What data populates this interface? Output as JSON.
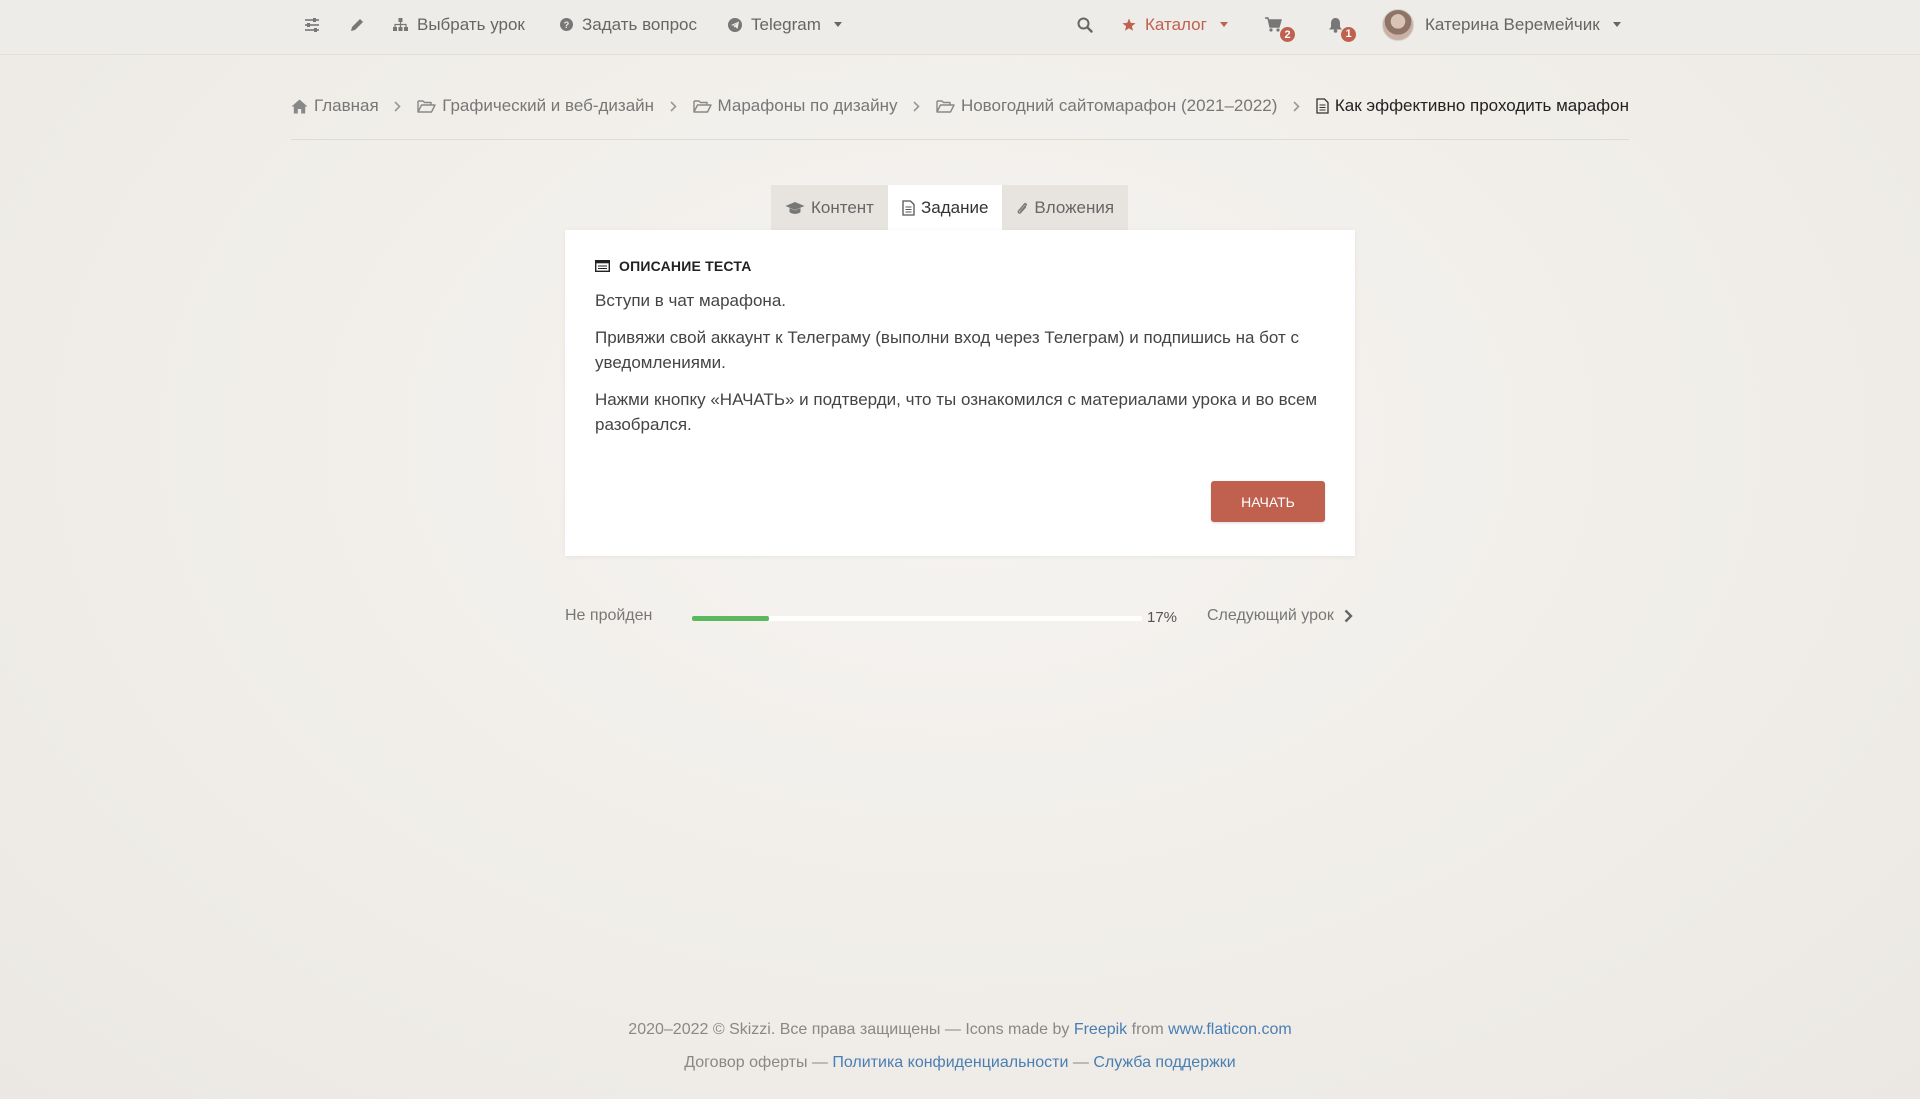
{
  "nav": {
    "choose_lesson": "Выбрать урок",
    "ask_question": "Задать вопрос",
    "telegram": "Telegram",
    "catalog": "Каталог",
    "cart_count": "2",
    "notifications_count": "1",
    "user_name": "Катерина Веремейчик"
  },
  "breadcrumb": {
    "home": "Главная",
    "level1": "Графический и веб-дизайн",
    "level2": "Марафоны по дизайну",
    "level3": "Новогодний сайтомарафон (2021–2022)",
    "current": "Как эффективно проходить марафон"
  },
  "tabs": {
    "content": "Контент",
    "task": "Задание",
    "attachments": "Вложения"
  },
  "card": {
    "title": "ОПИСАНИЕ ТЕСТА",
    "paragraphs": [
      "Вступи в чат марафона.",
      "Привяжи свой аккаунт к Телеграму (выполни вход через Телеграм) и подпишись на бот с уведомлениями.",
      "Нажми кнопку «НАЧАТЬ» и подтверди, что ты ознакомился с материалами урока и во всем разобрался."
    ],
    "start_button": "НАЧАТЬ"
  },
  "progress": {
    "status": "Не пройден",
    "percent": "17%",
    "fraction": 0.17,
    "next_lesson": "Следующий урок"
  },
  "footer": {
    "copyright": "2020–2022 © Skizzi. Все права защищены — Icons made by",
    "freepik": "Freepik",
    "from": "from",
    "flaticon": "www.flaticon.com",
    "offer": "Договор оферты —",
    "privacy": "Политика конфиденциальности",
    "dash": "—",
    "support": "Служба поддержки"
  },
  "colors": {
    "accent": "#c0604f",
    "progress": "#5cb85c",
    "link": "#4a7eb3"
  }
}
